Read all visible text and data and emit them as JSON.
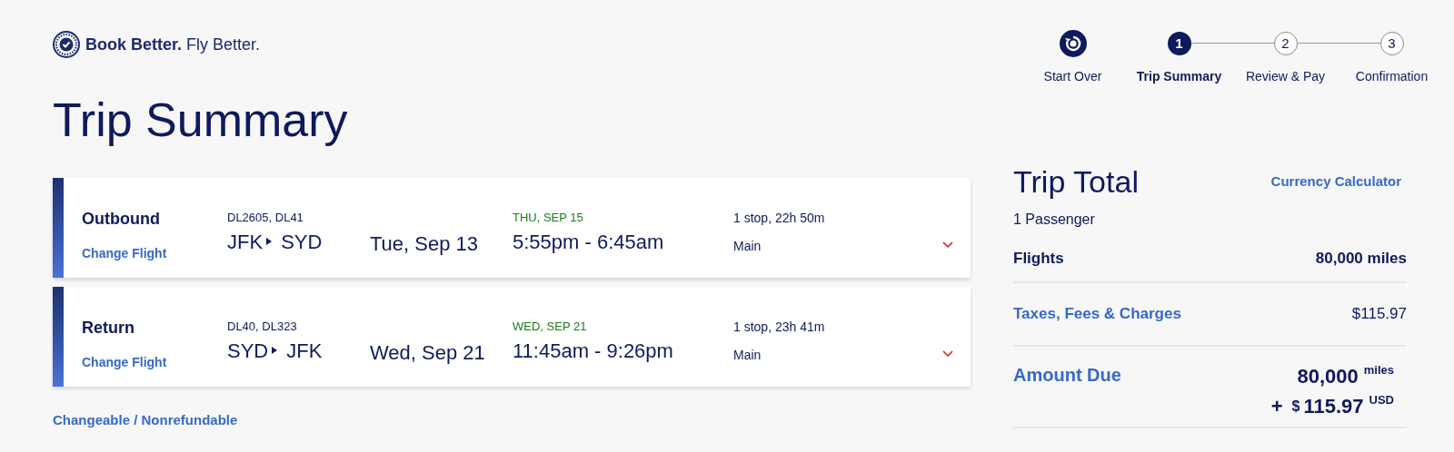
{
  "logo": {
    "bold": "Book Better.",
    "light": "Fly Better."
  },
  "steps": [
    {
      "kind": "restart",
      "label": "Start Over",
      "selected": false
    },
    {
      "kind": "step",
      "number": "1",
      "label": "Trip Summary",
      "selected": true
    },
    {
      "kind": "step",
      "number": "2",
      "label": "Review & Pay",
      "selected": false
    },
    {
      "kind": "step",
      "number": "3",
      "label": "Confirmation",
      "selected": false
    }
  ],
  "title": "Trip Summary",
  "flights": [
    {
      "direction": "Outbound",
      "link": "Change Flight",
      "flight_numbers": "DL2605, DL41",
      "origin": "JFK",
      "destination": "SYD",
      "date": "Tue, Sep 13",
      "arrival_day": "THU, SEP 15",
      "times": "5:55pm - 6:45am",
      "stops": "1 stop, 22h 50m",
      "cabin": "Main",
      "expanded": false
    },
    {
      "direction": "Return",
      "link": "Change Flight",
      "flight_numbers": "DL40, DL323",
      "origin": "SYD",
      "destination": "JFK",
      "date": "Wed, Sep 21",
      "arrival_day": "WED, SEP 21",
      "times": "11:45am - 9:26pm",
      "stops": "1 stop, 23h 41m",
      "cabin": "Main",
      "expanded": false
    }
  ],
  "fare_note": "Changeable / Nonrefundable",
  "total": {
    "title": "Trip Total",
    "calculator_link": "Currency Calculator",
    "passengers": "1 Passenger",
    "lines": [
      {
        "kind": "plain",
        "label": "Flights",
        "value": "80,000 miles"
      },
      {
        "kind": "link",
        "label": "Taxes, Fees & Charges",
        "value": "$115.97"
      }
    ],
    "amount_due": {
      "label": "Amount Due",
      "miles": "80,000",
      "miles_unit": "miles",
      "plus": "+",
      "currency_symbol": "$",
      "cash": "115.97",
      "currency": "USD"
    }
  }
}
